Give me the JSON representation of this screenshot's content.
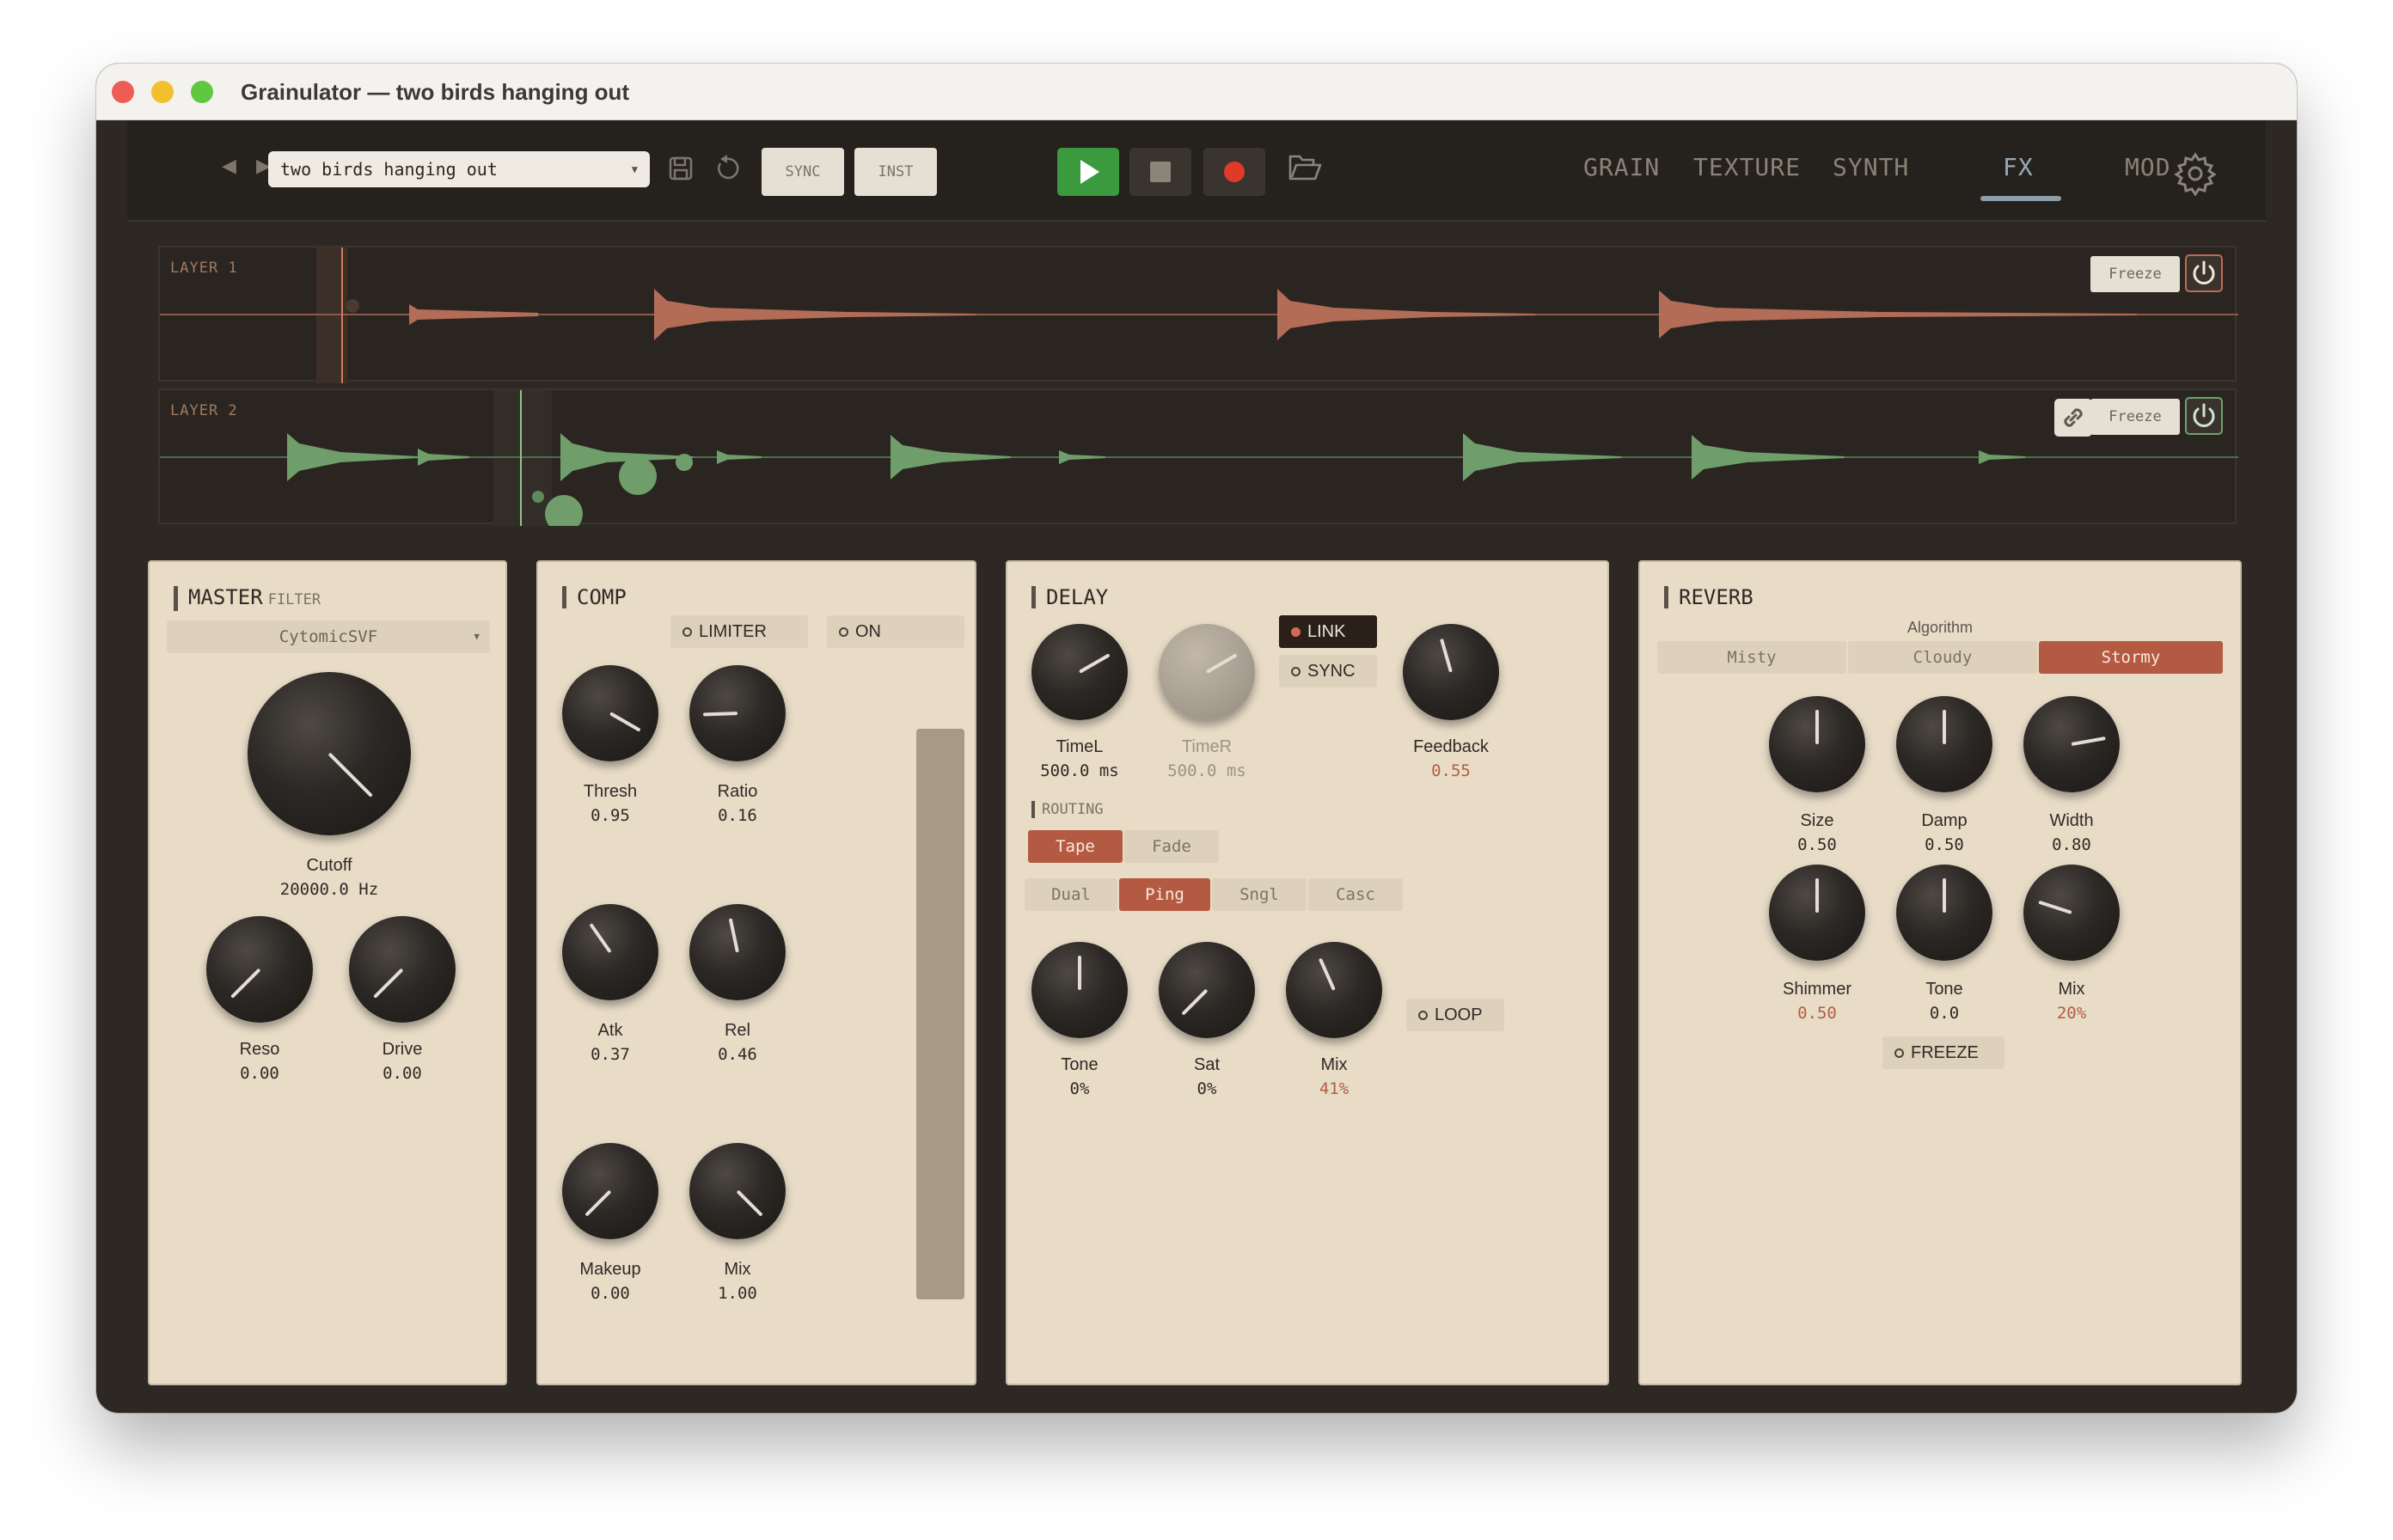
{
  "window": {
    "title": "Grainulator — two birds hanging out"
  },
  "toolbar": {
    "preset": "two birds hanging out",
    "sync_label": "SYNC",
    "inst_label": "INST",
    "tabs": [
      {
        "label": "GRAIN",
        "active": false
      },
      {
        "label": "TEXTURE",
        "active": false
      },
      {
        "label": "SYNTH",
        "active": false
      },
      {
        "label": "FX",
        "active": true
      },
      {
        "label": "MOD",
        "active": false
      }
    ],
    "colors": {
      "play": "#3c9a3e",
      "record": "#e03a2a",
      "tab_indicator": "#8e9ca8"
    }
  },
  "layers": [
    {
      "label": "LAYER 1",
      "freeze_label": "Freeze",
      "color": "#c4735b"
    },
    {
      "label": "LAYER 2",
      "freeze_label": "Freeze",
      "color": "#6fa36a"
    }
  ],
  "master": {
    "title": "MASTER",
    "subtitle": "FILTER",
    "filter_type": "CytomicSVF",
    "knobs": [
      {
        "label": "Cutoff",
        "value": "20000.0 Hz"
      },
      {
        "label": "Reso",
        "value": "0.00"
      },
      {
        "label": "Drive",
        "value": "0.00"
      }
    ]
  },
  "comp": {
    "title": "COMP",
    "limiter_label": "LIMITER",
    "on_label": "ON",
    "knobs": [
      {
        "label": "Thresh",
        "value": "0.95"
      },
      {
        "label": "Ratio",
        "value": "0.16"
      },
      {
        "label": "Atk",
        "value": "0.37"
      },
      {
        "label": "Rel",
        "value": "0.46"
      },
      {
        "label": "Makeup",
        "value": "0.00"
      },
      {
        "label": "Mix",
        "value": "1.00"
      }
    ]
  },
  "delay": {
    "title": "DELAY",
    "link_label": "LINK",
    "sync_label": "SYNC",
    "routing_label": "ROUTING",
    "mode_options": [
      "Tape",
      "Fade"
    ],
    "mode_selected": "Tape",
    "route_options": [
      "Dual",
      "Ping",
      "Sngl",
      "Casc"
    ],
    "route_selected": "Ping",
    "loop_label": "LOOP",
    "knobs": [
      {
        "label": "TimeL",
        "value": "500.0 ms"
      },
      {
        "label": "TimeR",
        "value": "500.0 ms"
      },
      {
        "label": "Feedback",
        "value": "0.55"
      },
      {
        "label": "Tone",
        "value": "0%"
      },
      {
        "label": "Sat",
        "value": "0%"
      },
      {
        "label": "Mix",
        "value": "41%"
      }
    ]
  },
  "reverb": {
    "title": "REVERB",
    "algorithm_label": "Algorithm",
    "algorithms": [
      "Misty",
      "Cloudy",
      "Stormy"
    ],
    "algorithm_selected": "Stormy",
    "freeze_label": "FREEZE",
    "knobs": [
      {
        "label": "Size",
        "value": "0.50"
      },
      {
        "label": "Damp",
        "value": "0.50"
      },
      {
        "label": "Width",
        "value": "0.80"
      },
      {
        "label": "Shimmer",
        "value": "0.50"
      },
      {
        "label": "Tone",
        "value": "0.0"
      },
      {
        "label": "Mix",
        "value": "20%"
      }
    ]
  },
  "colors": {
    "accent": "#b55a42",
    "panel": "#e8dcc7",
    "background": "#2d2823"
  }
}
